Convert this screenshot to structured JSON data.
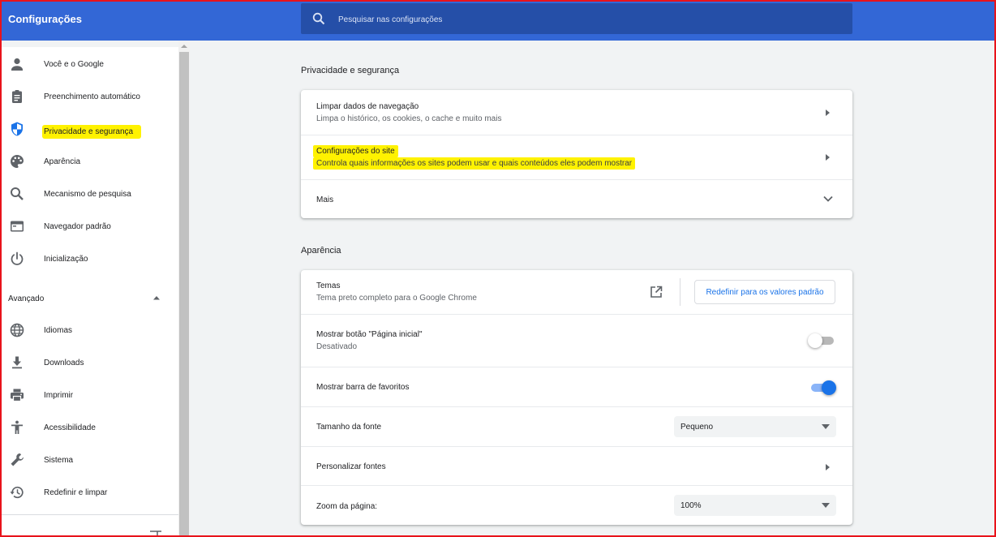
{
  "header": {
    "title": "Configurações",
    "search_placeholder": "Pesquisar nas configurações"
  },
  "sidebar": {
    "items": [
      {
        "label": "Você e o Google",
        "icon": "person-icon"
      },
      {
        "label": "Preenchimento automático",
        "icon": "clipboard-icon"
      },
      {
        "label": "Privacidade e segurança",
        "icon": "shield-icon",
        "highlighted": true
      },
      {
        "label": "Aparência",
        "icon": "palette-icon"
      },
      {
        "label": "Mecanismo de pesquisa",
        "icon": "search-icon"
      },
      {
        "label": "Navegador padrão",
        "icon": "browser-window-icon"
      },
      {
        "label": "Inicialização",
        "icon": "power-icon"
      }
    ],
    "advanced_label": "Avançado",
    "advanced_items": [
      {
        "label": "Idiomas",
        "icon": "globe-icon"
      },
      {
        "label": "Downloads",
        "icon": "download-icon"
      },
      {
        "label": "Imprimir",
        "icon": "printer-icon"
      },
      {
        "label": "Acessibilidade",
        "icon": "accessibility-icon"
      },
      {
        "label": "Sistema",
        "icon": "wrench-icon"
      },
      {
        "label": "Redefinir e limpar",
        "icon": "restore-icon"
      }
    ]
  },
  "privacy": {
    "title": "Privacidade e segurança",
    "rows": [
      {
        "title": "Limpar dados de navegação",
        "subtitle": "Limpa o histórico, os cookies, o cache e muito mais"
      },
      {
        "title": "Configurações do site",
        "subtitle": "Controla quais informações os sites podem usar e quais conteúdos eles podem mostrar"
      },
      {
        "title": "Mais"
      }
    ]
  },
  "appearance": {
    "title": "Aparência",
    "themes_title": "Temas",
    "themes_subtitle": "Tema preto completo para o Google Chrome",
    "reset_button": "Redefinir para os valores padrão",
    "home_button_title": "Mostrar botão \"Página inicial\"",
    "home_button_subtitle": "Desativado",
    "home_button_on": false,
    "bookmarks_bar_title": "Mostrar barra de favoritos",
    "bookmarks_bar_on": true,
    "font_size_title": "Tamanho da fonte",
    "font_size_value": "Pequeno",
    "customize_fonts_title": "Personalizar fontes",
    "zoom_title": "Zoom da página:",
    "zoom_value": "100%"
  },
  "colors": {
    "header": "#3367d6",
    "search_bg": "#254fa8",
    "accent": "#1a73e8",
    "highlight": "#fff200",
    "frame": "#e8131b"
  }
}
